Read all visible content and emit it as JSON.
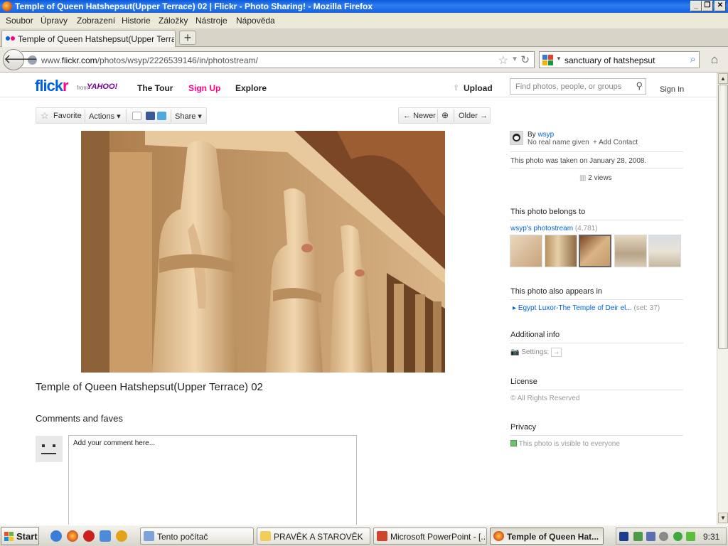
{
  "window": {
    "title": "Temple of Queen Hatshepsut(Upper Terrace) 02 | Flickr - Photo Sharing! - Mozilla Firefox"
  },
  "menubar": {
    "items": [
      "Soubor",
      "Úpravy",
      "Zobrazení",
      "Historie",
      "Záložky",
      "Nástroje",
      "Nápověda"
    ]
  },
  "tabs": {
    "active_label": "Temple of Queen Hatshepsut(Upper Terrace...",
    "new_tab": "+"
  },
  "navbar": {
    "url_prefix": "www.",
    "url_domain": "flickr.com",
    "url_path": "/photos/wsyp/2226539146/in/photostream/",
    "search_value": "sanctuary of hatshepsut"
  },
  "flickr_header": {
    "logo_a": "flick",
    "logo_b": "r",
    "from": "from",
    "yahoo": "YAHOO!",
    "nav": [
      "The Tour",
      "Sign Up",
      "Explore"
    ],
    "upload": "Upload",
    "search_placeholder": "Find photos, people, or groups",
    "sign_in": "Sign In"
  },
  "toolbar_left": {
    "favorite": "Favorite",
    "actions": "Actions",
    "share": "Share"
  },
  "toolbar_right": {
    "newer": "Newer",
    "older": "Older"
  },
  "photo": {
    "title": "Temple of Queen Hatshepsut(Upper Terrace) 02"
  },
  "comments": {
    "heading": "Comments and faves",
    "placeholder": "Add your comment here..."
  },
  "sidebar": {
    "by_label": "By",
    "owner": "wsyp",
    "owner_sub": "No real name given",
    "add_contact": "+ Add Contact",
    "taken": "This photo was taken on January 28, 2008.",
    "views": "2 views",
    "belongs_heading": "This photo belongs to",
    "photostream": "wsyp's photostream",
    "photostream_count": "(4,781)",
    "appears_heading": "This photo also appears in",
    "set_name": "Egypt Luxor-The Temple of Deir el...",
    "set_count": "(set: 37)",
    "additional_heading": "Additional info",
    "settings_label": "Settings:",
    "license_heading": "License",
    "license_value": "All Rights Reserved",
    "privacy_heading": "Privacy",
    "privacy_value": "This photo is visible to everyone"
  },
  "taskbar": {
    "start": "Start",
    "windows": [
      "Tento počítač",
      "PRAVĚK A STAROVĚK",
      "Microsoft PowerPoint - [...",
      "Temple of Queen Hat..."
    ],
    "clock": "9:31"
  },
  "colors": {
    "flickr_blue": "#0063dc",
    "flickr_pink": "#ff0084",
    "signup_color": "#ff0084"
  }
}
